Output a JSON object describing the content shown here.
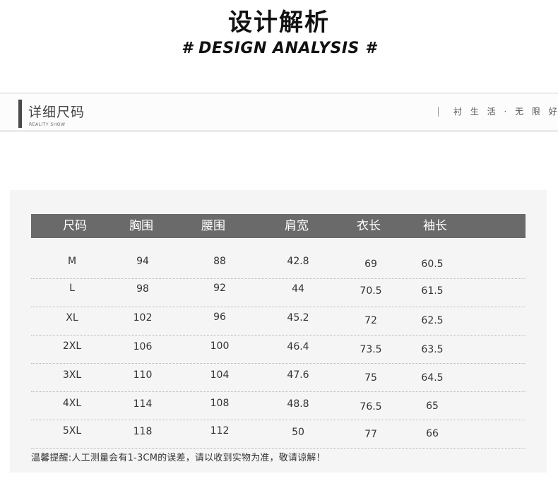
{
  "header": {
    "title_cn": "设计解析",
    "title_en": "# DESIGN ANALYSIS #"
  },
  "section": {
    "title": "详细尺码",
    "subtitle": "REALITY SHOW",
    "slogan": "衬 生 活 · 无 限 好"
  },
  "size_table": {
    "columns": [
      "尺码",
      "胸围",
      "腰围",
      "肩宽",
      "衣长",
      "袖长"
    ],
    "rows": [
      [
        "M",
        "94",
        "88",
        "42.8",
        "69",
        "60.5"
      ],
      [
        "L",
        "98",
        "92",
        "44",
        "70.5",
        "61.5"
      ],
      [
        "XL",
        "102",
        "96",
        "45.2",
        "72",
        "62.5"
      ],
      [
        "2XL",
        "106",
        "100",
        "46.4",
        "73.5",
        "63.5"
      ],
      [
        "3XL",
        "110",
        "104",
        "47.6",
        "75",
        "64.5"
      ],
      [
        "4XL",
        "114",
        "108",
        "48.8",
        "76.5",
        "65"
      ],
      [
        "5XL",
        "118",
        "112",
        "50",
        "77",
        "66"
      ]
    ],
    "note": "温馨提醒:人工测量会有1-3CM的误差，请以收到实物为准，敬请谅解！"
  },
  "colors": {
    "header_bg": "#6a6a6a",
    "panel_bg": "#f5f5f5",
    "accent_bar": "#4a4a4a"
  }
}
